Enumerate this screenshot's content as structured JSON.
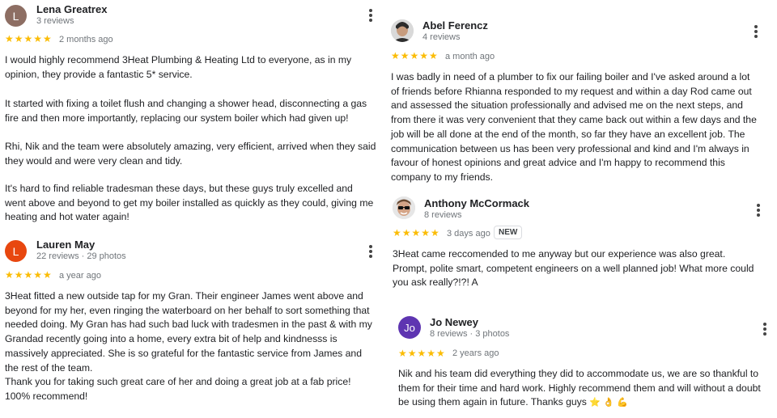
{
  "reviews": [
    {
      "avatar_letter": "L",
      "avatar_color": "#8d6e63",
      "name": "Lena Greatrex",
      "meta": "3 reviews",
      "stars": "★★★★★",
      "time": "2 months ago",
      "paragraphs": [
        "I would highly recommend 3Heat Plumbing & Heating Ltd to everyone, as in my\nopinion, they provide a fantastic 5* service.",
        "It started with fixing a toilet flush and changing a shower head, disconnecting a gas\nfire and then more importantly, replacing our system boiler which had given up!",
        "Rhi, Nik and the team were absolutely amazing, very efficient, arrived when they said\nthey would and were very clean and tidy.",
        "It's hard to find reliable tradesman these days, but these guys truly excelled and\nwent above and beyond to get my boiler installed as quickly as they could, giving me\nheating and hot water again!"
      ]
    },
    {
      "avatar_letter": "L",
      "avatar_color": "#e8470f",
      "name": "Lauren May",
      "meta": "22 reviews · 29 photos",
      "stars": "★★★★★",
      "time": "a year ago",
      "paragraphs": [
        "3Heat fitted a new outside tap for my Gran. Their engineer James went above and\nbeyond for my her, even ringing the waterboard on her behalf to sort something that\nneeded doing. My Gran has had such bad luck with tradesmen in the past & with my\nGrandad recently going into a home, every extra bit of help and kindnesss is\nmassively appreciated. She is so grateful for the fantastic service from James and\nthe rest of the team.\nThank you for taking such great care of her and doing a great job at a fab price!\n100% recommend!"
      ]
    },
    {
      "avatar_letter": "",
      "avatar_color": "#3b3b3b",
      "name": "Abel Ferencz",
      "meta": "4 reviews",
      "stars": "★★★★★",
      "time": "a month ago",
      "paragraphs": [
        "I was badly in need of a plumber to fix our failing boiler and I've asked around a lot\nof friends before Rhianna responded to my request and within a day Rod came out\nand assessed the situation professionally and advised me on the next steps, and\nfrom there it was very convenient that they came back out within a few days and the\njob will be all done at the end of the month, so far they have an excellent job. The\ncommunication between us has been very professional and kind and I'm always in\nfavour of honest opinions and great advice and I'm happy to recommend this\ncompany to my friends."
      ]
    },
    {
      "avatar_letter": "",
      "avatar_color": "#d8d8d8",
      "name": "Anthony McCormack",
      "meta": "8 reviews",
      "stars": "★★★★★",
      "time": "3 days ago",
      "badge": "NEW",
      "paragraphs": [
        "3Heat came reccomended to me anyway but our experience was also great.\nPrompt, polite smart, competent engineers on a well planned job! What more could\nyou ask really?!?! A"
      ]
    },
    {
      "avatar_letter": "Jo",
      "avatar_color": "#5e35b1",
      "name": "Jo Newey",
      "meta": "8 reviews · 3 photos",
      "stars": "★★★★★",
      "time": "2 years ago",
      "paragraphs": [
        "Nik and his team did everything they did to accommodate us, we are so thankful to\nthem for their time and hard work. Highly recommend them and will without a doubt\nbe using them again in future. Thanks guys"
      ],
      "emojis": [
        "⭐",
        "👌",
        "💪"
      ]
    }
  ]
}
